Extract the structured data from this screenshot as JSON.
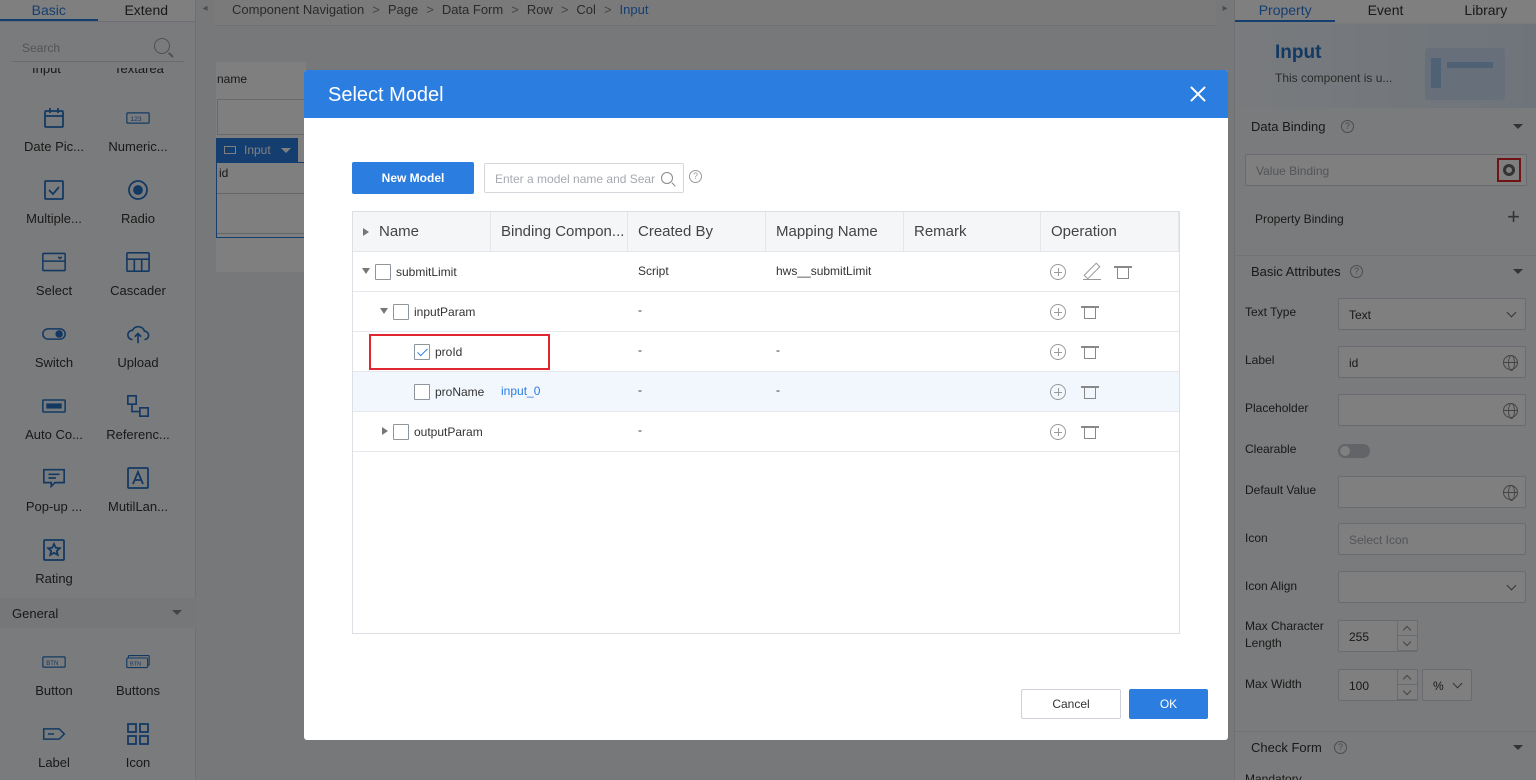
{
  "left_panel": {
    "tabs": [
      "Basic",
      "Extend"
    ],
    "search_placeholder": "Search",
    "cut_labels": [
      "Input",
      "Textarea"
    ],
    "components": [
      {
        "label": "Date Pic...",
        "icon": "calendar-icon"
      },
      {
        "label": "Numeric...",
        "icon": "numeric-icon"
      },
      {
        "label": "Multiple...",
        "icon": "checkbox-icon"
      },
      {
        "label": "Radio",
        "icon": "radio-icon"
      },
      {
        "label": "Select",
        "icon": "select-icon"
      },
      {
        "label": "Cascader",
        "icon": "cascader-icon"
      },
      {
        "label": "Switch",
        "icon": "switch-icon"
      },
      {
        "label": "Upload",
        "icon": "upload-icon"
      },
      {
        "label": "Auto Co...",
        "icon": "autocomplete-icon"
      },
      {
        "label": "Referenc...",
        "icon": "reference-icon"
      },
      {
        "label": "Pop-up ...",
        "icon": "popup-icon"
      },
      {
        "label": "MutilLan...",
        "icon": "multilang-icon"
      },
      {
        "label": "Rating",
        "icon": "star-icon"
      }
    ],
    "general_section": "General",
    "general_components": [
      {
        "label": "Button",
        "icon": "button-icon"
      },
      {
        "label": "Buttons",
        "icon": "buttons-icon"
      },
      {
        "label": "Label",
        "icon": "label-icon"
      },
      {
        "label": "Icon",
        "icon": "grid-icon"
      }
    ]
  },
  "breadcrumb": [
    "Component Navigation",
    "Page",
    "Data Form",
    "Row",
    "Col",
    "Input"
  ],
  "canvas": {
    "field_label": "name",
    "input_tag": "Input",
    "selected_field_text": "id"
  },
  "right_panel": {
    "tabs": [
      "Property",
      "Event",
      "Library"
    ],
    "component_title": "Input",
    "component_desc": "This component is u...",
    "data_binding": {
      "title": "Data Binding",
      "value_binding_placeholder": "Value Binding",
      "property_binding_label": "Property Binding"
    },
    "basic_attributes": {
      "title": "Basic Attributes",
      "text_type_label": "Text Type",
      "text_type_value": "Text",
      "label_label": "Label",
      "label_value": "id",
      "placeholder_label": "Placeholder",
      "clearable_label": "Clearable",
      "default_value_label": "Default Value",
      "icon_label": "Icon",
      "icon_placeholder": "Select Icon",
      "icon_align_label": "Icon Align",
      "max_char_label_1": "Max Character",
      "max_char_label_2": "Length",
      "max_char_value": "255",
      "max_width_label": "Max Width",
      "max_width_value": "100",
      "max_width_unit": "%"
    },
    "check_form": {
      "title": "Check Form",
      "mandatory_label": "Mandatory"
    }
  },
  "dialog": {
    "title": "Select Model",
    "new_model_button": "New Model",
    "search_placeholder": "Enter a model name and Search",
    "columns": [
      "Name",
      "Binding Compon...",
      "Created By",
      "Mapping Name",
      "Remark",
      "Operation"
    ],
    "rows": [
      {
        "name": "submitLimit",
        "binding": "",
        "created_by": "Script",
        "mapping": "hws__submitLimit",
        "remark": "",
        "checked": false,
        "expander": "down"
      },
      {
        "name": "inputParam",
        "binding": "",
        "created_by": "-",
        "mapping": "",
        "remark": "",
        "checked": false,
        "expander": "down"
      },
      {
        "name": "proId",
        "binding": "",
        "created_by": "-",
        "mapping": "-",
        "remark": "",
        "checked": true,
        "expander": "none"
      },
      {
        "name": "proName",
        "binding": "input_0",
        "created_by": "-",
        "mapping": "-",
        "remark": "",
        "checked": false,
        "expander": "none"
      },
      {
        "name": "outputParam",
        "binding": "",
        "created_by": "-",
        "mapping": "",
        "remark": "",
        "checked": false,
        "expander": "right"
      }
    ],
    "cancel_button": "Cancel",
    "ok_button": "OK"
  },
  "colors": {
    "primary": "#2b7de0",
    "highlight": "#e0262f",
    "link": "#2b7de0"
  }
}
